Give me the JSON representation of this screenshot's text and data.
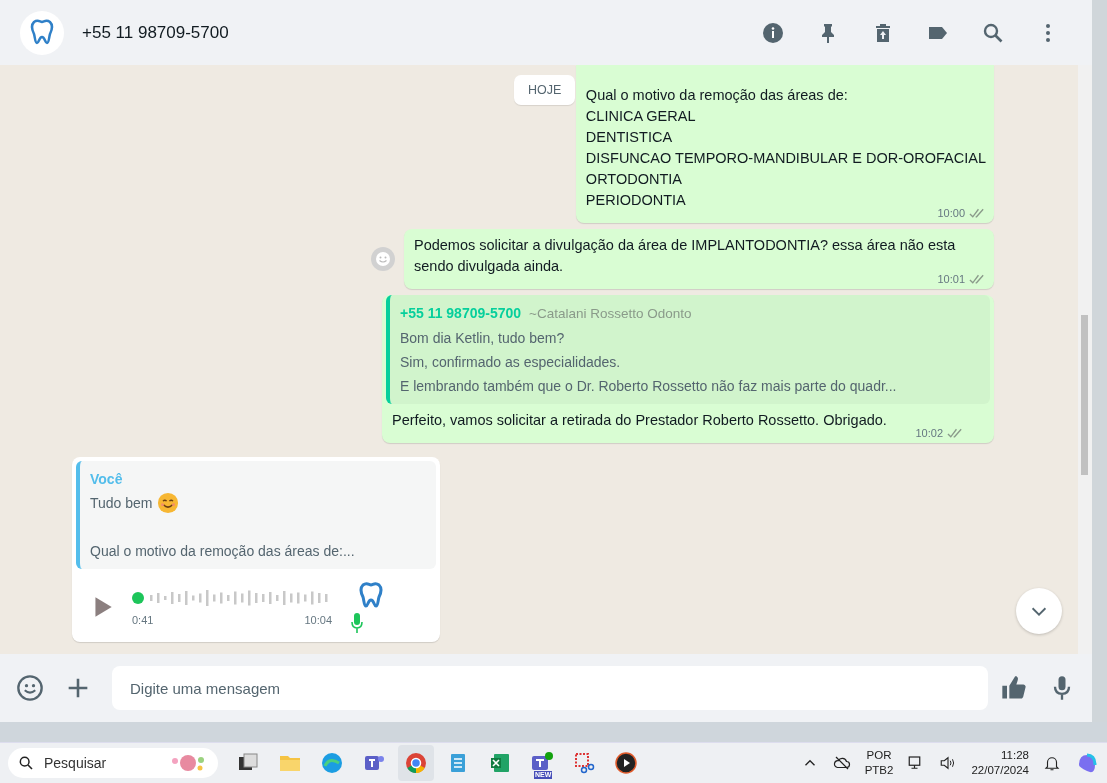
{
  "header": {
    "contact": "+55 11 98709-5700"
  },
  "chat": {
    "date_chip": "HOJE",
    "messages": [
      {
        "kind": "text",
        "outgoing": true,
        "lines": [
          "Qual o motivo da remoção das áreas de:",
          "CLINICA GERAL",
          "DENTISTICA",
          "DISFUNCAO TEMPORO-MANDIBULAR E DOR-OROFACIAL",
          "ORTODONTIA",
          "PERIODONTIA"
        ],
        "time": "10:00"
      },
      {
        "kind": "text",
        "outgoing": true,
        "lines": [
          "Podemos solicitar a divulgação da área de IMPLANTODONTIA? essa área não esta sendo divulgada ainda."
        ],
        "time": "10:01",
        "reaction_button": true
      },
      {
        "kind": "reply",
        "outgoing": true,
        "quote": {
          "author": "+55 11 98709-5700",
          "author_name": "~Catalani Rossetto Odonto",
          "lines": [
            "Bom dia Ketlin, tudo bem?",
            "Sim, confirmado as especialidades.",
            "E lembrando também que o Dr. Roberto Rossetto não faz mais parte do quadr..."
          ]
        },
        "lines": [
          "Perfeito, vamos solicitar a retirada do Prestador Roberto Rossetto. Obrigado."
        ],
        "time": "10:02"
      },
      {
        "kind": "audio",
        "outgoing": false,
        "quote": {
          "author": "Você",
          "lines": [
            "Tudo bem",
            "Qual o motivo da remoção das áreas de:..."
          ]
        },
        "duration": "0:41",
        "time": "10:04"
      }
    ]
  },
  "composer": {
    "placeholder": "Digite uma mensagem"
  },
  "taskbar": {
    "search": "Pesquisar",
    "badge": "NEW",
    "language": "POR",
    "layout": "PTB2",
    "clock_time": "11:28",
    "clock_date": "22/07/2024"
  }
}
